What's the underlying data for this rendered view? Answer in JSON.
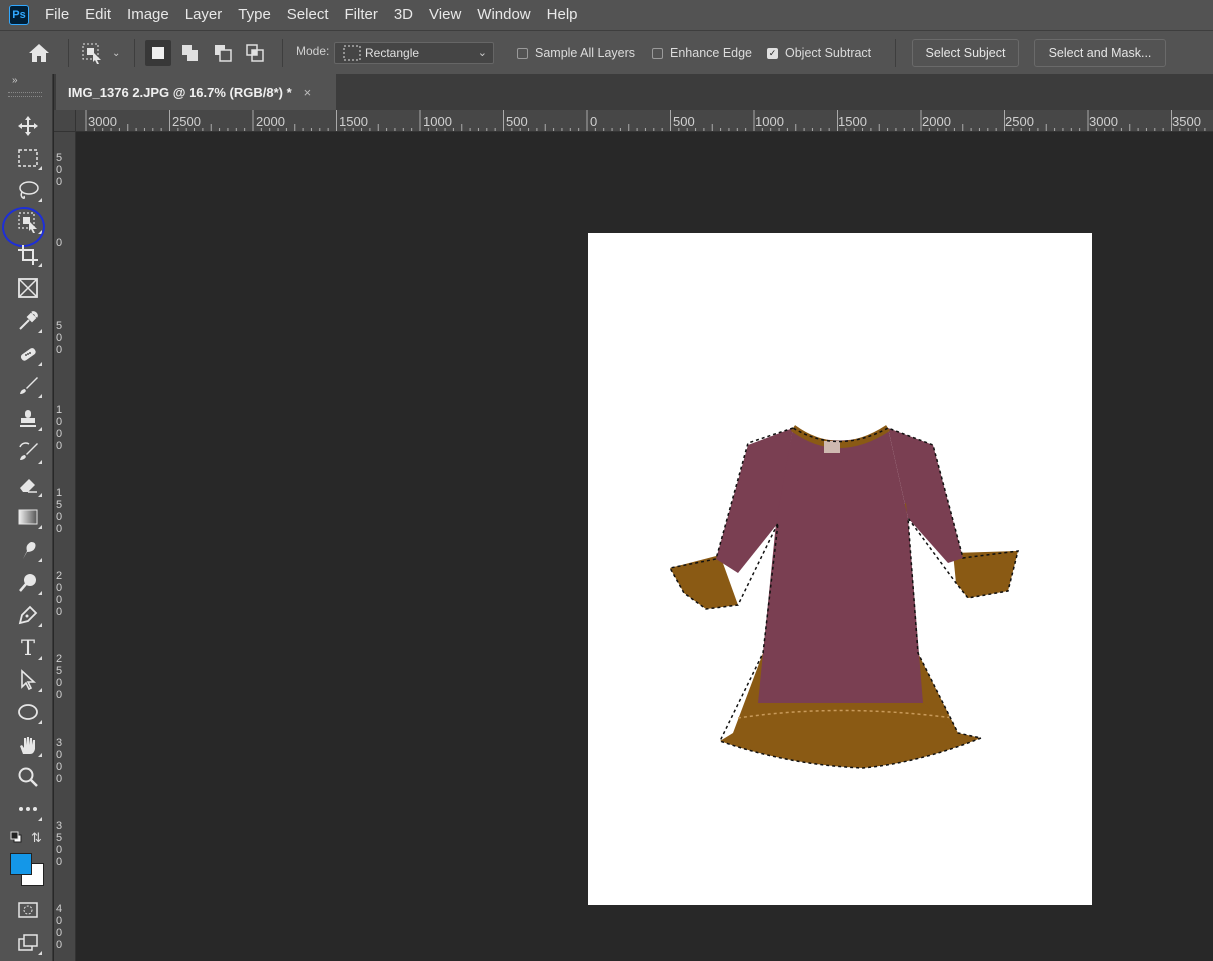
{
  "app": {
    "logo_text": "Ps"
  },
  "menu": [
    "File",
    "Edit",
    "Image",
    "Layer",
    "Type",
    "Select",
    "Filter",
    "3D",
    "View",
    "Window",
    "Help"
  ],
  "options": {
    "mode_label": "Mode:",
    "mode_value": "Rectangle",
    "sample_all_layers": {
      "label": "Sample All Layers",
      "checked": false
    },
    "enhance_edge": {
      "label": "Enhance Edge",
      "checked": false
    },
    "object_subtract": {
      "label": "Object Subtract",
      "checked": true
    },
    "select_subject_label": "Select Subject",
    "select_and_mask_label": "Select and Mask..."
  },
  "document": {
    "tab_title": "IMG_1376 2.JPG @ 16.7% (RGB/8*) *",
    "close_glyph": "×"
  },
  "ruler": {
    "horizontal": [
      "3000",
      "2500",
      "2000",
      "1500",
      "1000",
      "500",
      "0",
      "500",
      "1000",
      "1500",
      "2000",
      "2500",
      "3000",
      "3500"
    ],
    "vertical": [
      "500",
      "0",
      "500",
      "1000",
      "1500",
      "2000",
      "2500",
      "3000",
      "3500",
      "4000"
    ]
  },
  "colors": {
    "foreground": "#1497e8",
    "background": "#ffffff",
    "highlight_circle": "#1d2fd8",
    "dress_body": "#7a3f52",
    "dress_trim": "#8a5a14"
  },
  "tools": [
    "move-icon",
    "rectangular-marquee-icon",
    "lasso-icon",
    "object-selection-icon",
    "crop-icon",
    "frame-icon",
    "eyedropper-icon",
    "spot-healing-icon",
    "brush-icon",
    "clone-stamp-icon",
    "history-brush-icon",
    "eraser-icon",
    "gradient-icon",
    "smudge-icon",
    "dodge-icon",
    "pen-icon",
    "type-icon",
    "path-selection-icon",
    "ellipse-icon",
    "hand-icon",
    "zoom-icon",
    "more-tools-icon"
  ],
  "type_tool_glyph": "T"
}
